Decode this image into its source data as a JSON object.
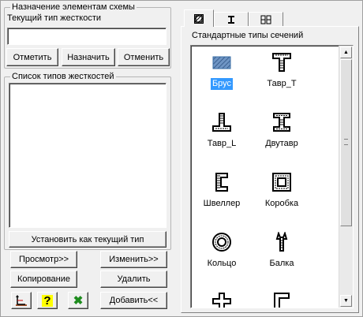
{
  "assign_group": {
    "legend": "Назначение элементам схемы",
    "current_label": "Текущий тип жесткости",
    "current_value": "",
    "mark_label": "Отметить",
    "assign_label": "Назначить",
    "cancel_label": "Отменить"
  },
  "list_group": {
    "legend": "Список типов жесткостей",
    "items": [],
    "set_current_label": "Установить как текущий тип",
    "view_label": "Просмотр>>",
    "edit_label": "Изменить>>",
    "copy_label": "Копирование",
    "delete_label": "Удалить",
    "add_label": "Добавить<<"
  },
  "tabs": [
    {
      "icon": "hatched-section-icon",
      "active": true
    },
    {
      "icon": "i-beam-tab-icon",
      "active": false
    },
    {
      "icon": "composite-section-tab-icon",
      "active": false
    }
  ],
  "section_panel": {
    "title": "Стандартные типы сечений",
    "items": [
      {
        "label": "Брус",
        "icon": "rectangular-bar-icon",
        "selected": true
      },
      {
        "label": "Тавр_Т",
        "icon": "tee-section-icon",
        "selected": false
      },
      {
        "label": "Тавр_L",
        "icon": "inverted-tee-section-icon",
        "selected": false
      },
      {
        "label": "Двутавр",
        "icon": "i-beam-icon",
        "selected": false
      },
      {
        "label": "Швеллер",
        "icon": "channel-icon",
        "selected": false
      },
      {
        "label": "Коробка",
        "icon": "box-section-icon",
        "selected": false
      },
      {
        "label": "Кольцо",
        "icon": "ring-section-icon",
        "selected": false
      },
      {
        "label": "Балка",
        "icon": "beam-section-icon",
        "selected": false
      }
    ]
  },
  "colors": {
    "selection": "#3399ff",
    "hatch_blue": "#3a6ea5",
    "section_black": "#000000",
    "ok_green": "#1e8c1e",
    "help_yellow": "#ffff00"
  }
}
